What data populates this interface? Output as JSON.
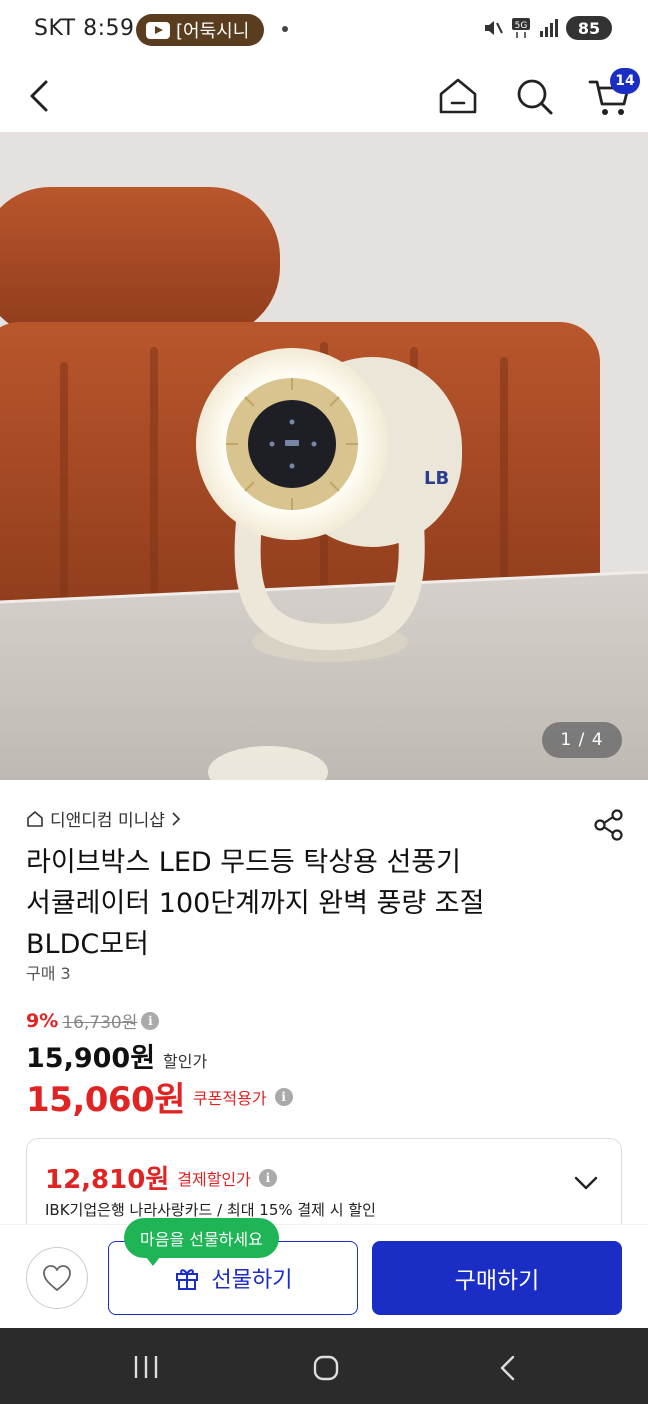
{
  "status_bar": {
    "carrier_time": "SKT 8:59",
    "media_title": "[어둑시니",
    "battery": "85",
    "icons": [
      "mute-icon",
      "5g-icon",
      "signal-icon",
      "battery-icon"
    ]
  },
  "header": {
    "icons": [
      "back-arrow-icon",
      "home-icon",
      "search-icon",
      "cart-icon"
    ],
    "cart_count": "14"
  },
  "image": {
    "counter": "1 / 4"
  },
  "product": {
    "store_name": "디앤디컴 미니샵",
    "title_lines": [
      "라이브박스 LED 무드등 탁상용 선풍기",
      "서큘레이터 100단계까지 완벽 풍량 조절",
      "BLDC모터"
    ],
    "purchase_count": "구매 3"
  },
  "pricing": {
    "discount_pct": "9%",
    "original_price": "16,730원",
    "sale_price": "15,900원",
    "sale_label": "할인가",
    "coupon_price": "15,060원",
    "coupon_label": "쿠폰적용가",
    "payment_price": "12,810원",
    "payment_label": "결제할인가",
    "payment_desc": "IBK기업은행 나라사랑카드 / 최대 15% 결제 시 할인",
    "info_glyph": "i"
  },
  "actions": {
    "gift_tooltip": "마음을 선물하세요",
    "gift_label": "선물하기",
    "buy_label": "구매하기"
  },
  "colors": {
    "accent_blue": "#1a2dc4",
    "price_red": "#e02424",
    "tooltip_green": "#1fb456"
  }
}
